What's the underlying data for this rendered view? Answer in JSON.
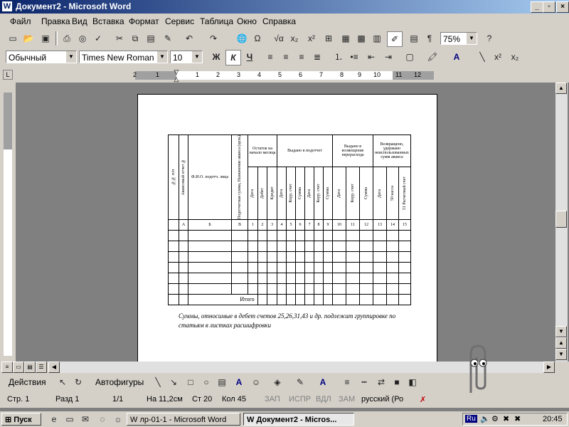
{
  "window": {
    "title": "Документ2 - Microsoft Word",
    "min": "_",
    "max": "▫",
    "close": "×"
  },
  "menu": [
    "Файл",
    "Правка",
    "Вид",
    "Вставка",
    "Формат",
    "Сервис",
    "Таблица",
    "Окно",
    "Справка"
  ],
  "toolbar1": {
    "zoom": "75%"
  },
  "toolbar2": {
    "style": "Обычный",
    "font": "Times New Roman",
    "size": "10",
    "bold": "Ж",
    "italic": "К",
    "underline": "Ч"
  },
  "ruler": {
    "numbers": [
      "2",
      "1",
      "1",
      "2",
      "3",
      "4",
      "5",
      "6",
      "7",
      "8",
      "9",
      "10",
      "11",
      "12"
    ]
  },
  "doc": {
    "headers": {
      "num": "№№ п/п",
      "avans": "Авансовый отчет №",
      "fio": "Ф.И.О. подотч. лица",
      "purpose": "Подотчетная сумма, Назначение аванса (цель)",
      "ostatok": "Остаток на начало месяца",
      "debet": "Дебет",
      "kredit": "Кредит",
      "vydano": "Выдано в подотчет",
      "data": "Дата",
      "korr": "Корр. счет",
      "summa": "Сумма",
      "vozm": "Выдано в возмещение перерасхода",
      "vozvr": "Возвращено, удержано неиспользованных сумм аванса",
      "s50": "50 касса",
      "s31": "51 Расчетный счет"
    },
    "index_row": [
      "А",
      "Б",
      "В",
      "1",
      "2",
      "3",
      "4",
      "5",
      "6",
      "7",
      "8",
      "9",
      "10",
      "11",
      "12",
      "13",
      "14",
      "15"
    ],
    "total": "Итого",
    "note": "Суммы, относимые в дебет счетов 25,26,31,43 и др. подлежат группировке по статьям в листках расшифровки"
  },
  "drawing": {
    "actions": "Действия",
    "autoshapes": "Автофигуры"
  },
  "status": {
    "page": "Стр. 1",
    "section": "Разд 1",
    "pages": "1/1",
    "at": "На 11,2см",
    "line": "Ст 20",
    "col": "Кол 45",
    "rec": "ЗАП",
    "trk": "ИСПР",
    "ext": "ВДЛ",
    "ovr": "ЗАМ",
    "lang": "русский (Ро"
  },
  "taskbar": {
    "start": "Пуск",
    "task1": "лр-01-1 - Microsoft Word",
    "task2": "Документ2 - Micros...",
    "lang": "Ru",
    "clock": "20:45"
  }
}
